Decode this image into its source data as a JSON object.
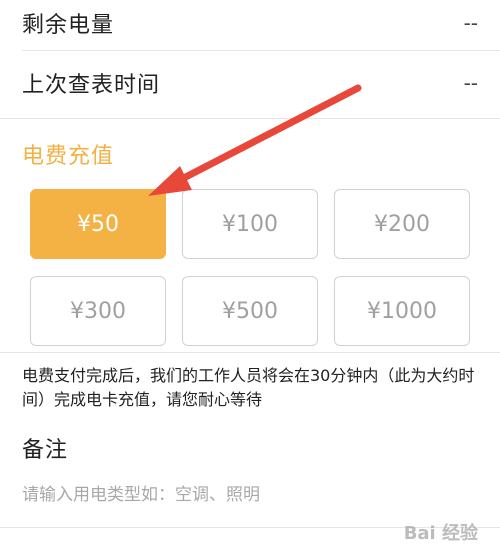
{
  "info": {
    "remaining_label": "剩余电量",
    "remaining_value": "--",
    "last_read_label": "上次查表时间",
    "last_read_value": "--"
  },
  "recharge": {
    "title": "电费充值",
    "amounts": [
      "¥50",
      "¥100",
      "¥200",
      "¥300",
      "¥500",
      "¥1000"
    ],
    "selected": "¥50"
  },
  "notice": "电费支付完成后，我们的工作人员将会在30分钟内（此为大约时间）完成电卡充值，请您耐心等待",
  "remark": {
    "title": "备注",
    "placeholder": "请输入用电类型如：空调、照明"
  },
  "watermark": "Bai 经验",
  "colors": {
    "accent": "#f4b245",
    "arrow": "#e8483a"
  }
}
